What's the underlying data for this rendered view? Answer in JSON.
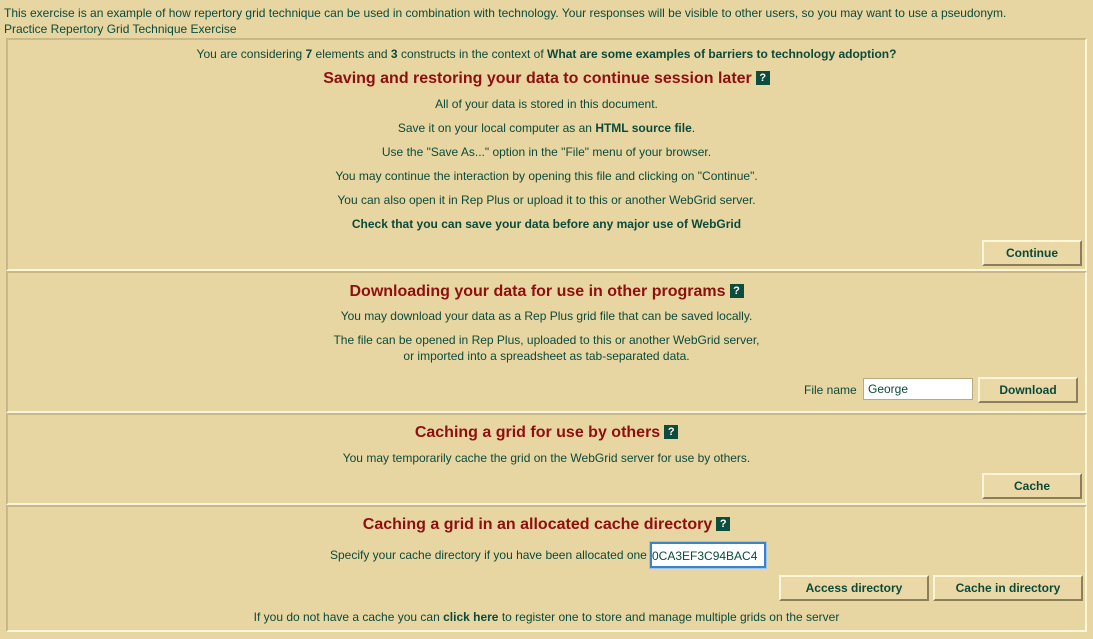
{
  "intro": {
    "line1": "This exercise is an example of how repertory grid technique can be used in combination with technology. Your responses will be visible to other users, so you may want to use a pseudonym.",
    "line2": "Practice Repertory Grid Technique Exercise"
  },
  "context": {
    "prefix": "You are considering ",
    "elements_count": "7",
    "mid1": " elements and ",
    "constructs_count": "3",
    "mid2": " constructs in the context of ",
    "question": "What are some examples of barriers to technology adoption?"
  },
  "saving": {
    "heading": "Saving and restoring your data to continue session later",
    "help": "?",
    "line1": "All of your data is stored in this document.",
    "line2_prefix": "Save it on your local computer as an ",
    "line2_bold": "HTML source file",
    "line2_suffix": ".",
    "line3": "Use the \"Save As...\" option in the \"File\" menu of your browser.",
    "line4": "You may continue the interaction by opening this file and clicking on \"Continue\".",
    "line5": "You can also open it in Rep Plus or upload it to this or another WebGrid server.",
    "line6": "Check that you can save your data before any major use of WebGrid",
    "continue_label": "Continue"
  },
  "download": {
    "heading": "Downloading your data for use in other programs",
    "help": "?",
    "line1": "You may download your data as a Rep Plus grid file that can be saved locally.",
    "line2": "The file can be opened in Rep Plus, uploaded to this or another WebGrid server,",
    "line3": "or imported into a spreadsheet as tab-separated data.",
    "file_name_label": "File name",
    "file_name_value": "George",
    "download_label": "Download"
  },
  "cache": {
    "heading": "Caching a grid for use by others",
    "help": "?",
    "line1": "You may temporarily cache the grid on the WebGrid server for use by others.",
    "cache_label": "Cache"
  },
  "alloc": {
    "heading": "Caching a grid in an allocated cache directory",
    "help": "?",
    "dir_label": "Specify your cache directory if you have been allocated one",
    "dir_value": "0CA3EF3C94BAC4",
    "access_label": "Access directory",
    "cache_dir_label": "Cache in directory",
    "footer_prefix": "If you do not have a cache you can ",
    "footer_link": "click here",
    "footer_suffix": " to register one to store and manage multiple grids on the server"
  }
}
